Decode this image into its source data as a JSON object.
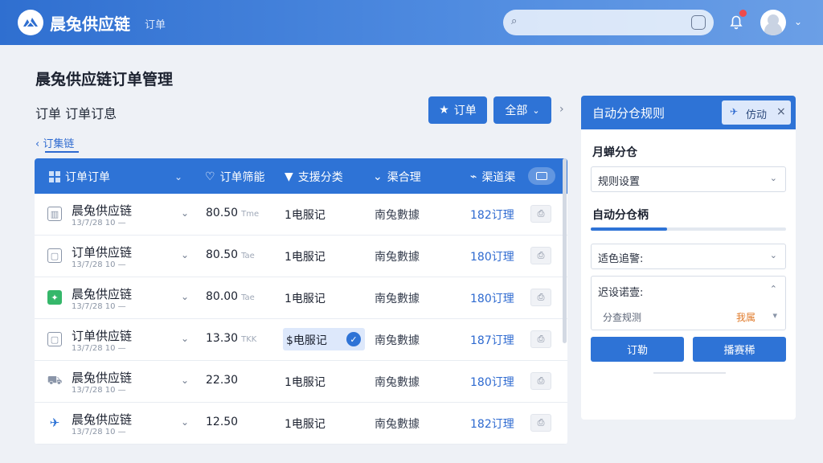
{
  "header": {
    "app_name": "晨兔供应链",
    "sub_label": "订单",
    "search_placeholder": "",
    "notification_count": ""
  },
  "page": {
    "title": "晨兔供应链订单管理",
    "sub_tabs": "订单  订单订息",
    "back_link": "‹ 订集链"
  },
  "toolbar": {
    "order_button": "订单",
    "all_button": "全部"
  },
  "table": {
    "columns": [
      "订单订单",
      "订单筛能",
      "支援分类",
      "渠合理",
      "渠道渠"
    ],
    "rows": [
      {
        "name": "晨兔供应链",
        "time": "13/7/28 10 —",
        "amount": "80.50",
        "amount_unit": "Tme",
        "type": "1电服记",
        "manager": "南兔數據",
        "link": "182订理",
        "icon": "▥",
        "selected": false
      },
      {
        "name": "订单供应链",
        "time": "13/7/28 10 —",
        "amount": "80.50",
        "amount_unit": "Tae",
        "type": "1电服记",
        "manager": "南兔數據",
        "link": "180订理",
        "icon": "▢",
        "selected": false
      },
      {
        "name": "晨兔供应链",
        "time": "13/7/28 10 —",
        "amount": "80.00",
        "amount_unit": "Tae",
        "type": "1电服记",
        "manager": "南兔數據",
        "link": "180订理",
        "icon": "✦",
        "selected": false
      },
      {
        "name": "订单供应链",
        "time": "13/7/28 10 —",
        "amount": "13.30",
        "amount_unit": "TKK",
        "type": "$电服记",
        "manager": "南兔數據",
        "link": "187订理",
        "icon": "▢",
        "selected": true
      },
      {
        "name": "晨兔供应链",
        "time": "13/7/28 10 —",
        "amount": "22.30",
        "amount_unit": "",
        "type": "1电服记",
        "manager": "南兔數據",
        "link": "180订理",
        "icon": "⛟",
        "selected": false
      },
      {
        "name": "晨兔供应链",
        "time": "13/7/28 10 —",
        "amount": "12.50",
        "amount_unit": "",
        "type": "1电服记",
        "manager": "南兔數據",
        "link": "182订理",
        "icon": "✈",
        "selected": false
      }
    ]
  },
  "panel": {
    "title": "自动分仓规则",
    "chip_label": "仿动",
    "section1_label": "月蝉分仓",
    "select1_value": "规则设置",
    "section2_label": "自动分仓柄",
    "progress": 0.39,
    "select2_value": "适色追警:",
    "box_title": "迟设诺壹:",
    "box_key": "分查规测",
    "box_value": "我属",
    "button_left": "订勒",
    "button_right": "播赛稀"
  },
  "colors": {
    "primary": "#2e73d6",
    "topbar_start": "#2f6fd0",
    "topbar_end": "#6b9fe6",
    "link": "#2e6ad0",
    "accent_orange": "#e07a2a",
    "badge_red": "#ef4b4b",
    "success_green": "#35b76a"
  },
  "icons": {
    "logo": "leaf-logo-icon",
    "search": "search-icon",
    "bell": "bell-icon",
    "star": "star-icon",
    "grid": "grid-icon"
  }
}
